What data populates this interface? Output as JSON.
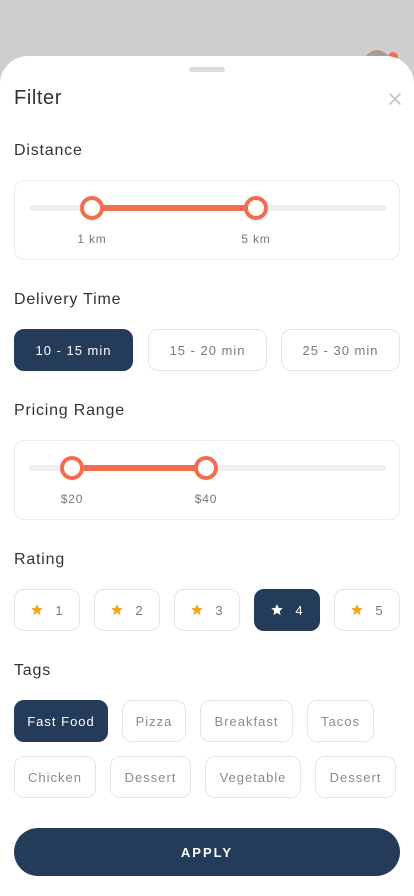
{
  "sheet": {
    "title": "Filter"
  },
  "distance": {
    "title": "Distance",
    "min_label": "1 km",
    "max_label": "5 km"
  },
  "delivery_time": {
    "title": "Delivery Time",
    "options": [
      "10 - 15 min",
      "15 - 20 min",
      "25 - 30 min"
    ],
    "selected": "10 - 15 min"
  },
  "pricing": {
    "title": "Pricing Range",
    "min_label": "$20",
    "max_label": "$40"
  },
  "rating": {
    "title": "Rating",
    "options": [
      "1",
      "2",
      "3",
      "4",
      "5"
    ],
    "selected": "4"
  },
  "tags": {
    "title": "Tags",
    "items": [
      "Fast Food",
      "Pizza",
      "Breakfast",
      "Tacos",
      "Chicken",
      "Dessert",
      "Vegetable",
      "Dessert"
    ],
    "selected": "Fast Food"
  },
  "apply_label": "APPLY",
  "colors": {
    "accent": "#f26d4f",
    "primary": "#243c59",
    "star": "#f6a623"
  },
  "icons": {
    "close": "close-icon",
    "star": "star-icon"
  }
}
